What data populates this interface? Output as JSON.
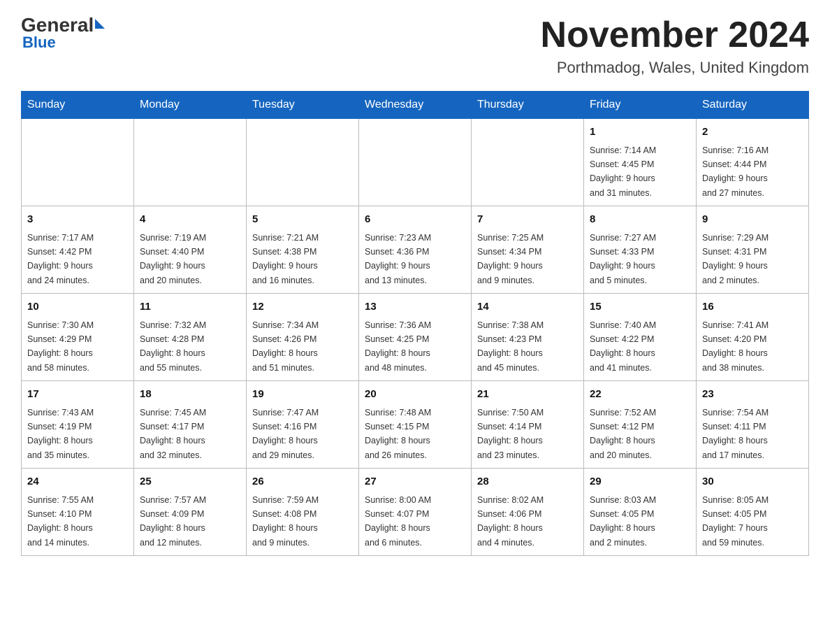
{
  "header": {
    "logo_general": "General",
    "logo_blue": "Blue",
    "title": "November 2024",
    "subtitle": "Porthmadog, Wales, United Kingdom"
  },
  "weekdays": [
    "Sunday",
    "Monday",
    "Tuesday",
    "Wednesday",
    "Thursday",
    "Friday",
    "Saturday"
  ],
  "rows": [
    {
      "cells": [
        {
          "day": "",
          "info": ""
        },
        {
          "day": "",
          "info": ""
        },
        {
          "day": "",
          "info": ""
        },
        {
          "day": "",
          "info": ""
        },
        {
          "day": "",
          "info": ""
        },
        {
          "day": "1",
          "info": "Sunrise: 7:14 AM\nSunset: 4:45 PM\nDaylight: 9 hours\nand 31 minutes."
        },
        {
          "day": "2",
          "info": "Sunrise: 7:16 AM\nSunset: 4:44 PM\nDaylight: 9 hours\nand 27 minutes."
        }
      ]
    },
    {
      "cells": [
        {
          "day": "3",
          "info": "Sunrise: 7:17 AM\nSunset: 4:42 PM\nDaylight: 9 hours\nand 24 minutes."
        },
        {
          "day": "4",
          "info": "Sunrise: 7:19 AM\nSunset: 4:40 PM\nDaylight: 9 hours\nand 20 minutes."
        },
        {
          "day": "5",
          "info": "Sunrise: 7:21 AM\nSunset: 4:38 PM\nDaylight: 9 hours\nand 16 minutes."
        },
        {
          "day": "6",
          "info": "Sunrise: 7:23 AM\nSunset: 4:36 PM\nDaylight: 9 hours\nand 13 minutes."
        },
        {
          "day": "7",
          "info": "Sunrise: 7:25 AM\nSunset: 4:34 PM\nDaylight: 9 hours\nand 9 minutes."
        },
        {
          "day": "8",
          "info": "Sunrise: 7:27 AM\nSunset: 4:33 PM\nDaylight: 9 hours\nand 5 minutes."
        },
        {
          "day": "9",
          "info": "Sunrise: 7:29 AM\nSunset: 4:31 PM\nDaylight: 9 hours\nand 2 minutes."
        }
      ]
    },
    {
      "cells": [
        {
          "day": "10",
          "info": "Sunrise: 7:30 AM\nSunset: 4:29 PM\nDaylight: 8 hours\nand 58 minutes."
        },
        {
          "day": "11",
          "info": "Sunrise: 7:32 AM\nSunset: 4:28 PM\nDaylight: 8 hours\nand 55 minutes."
        },
        {
          "day": "12",
          "info": "Sunrise: 7:34 AM\nSunset: 4:26 PM\nDaylight: 8 hours\nand 51 minutes."
        },
        {
          "day": "13",
          "info": "Sunrise: 7:36 AM\nSunset: 4:25 PM\nDaylight: 8 hours\nand 48 minutes."
        },
        {
          "day": "14",
          "info": "Sunrise: 7:38 AM\nSunset: 4:23 PM\nDaylight: 8 hours\nand 45 minutes."
        },
        {
          "day": "15",
          "info": "Sunrise: 7:40 AM\nSunset: 4:22 PM\nDaylight: 8 hours\nand 41 minutes."
        },
        {
          "day": "16",
          "info": "Sunrise: 7:41 AM\nSunset: 4:20 PM\nDaylight: 8 hours\nand 38 minutes."
        }
      ]
    },
    {
      "cells": [
        {
          "day": "17",
          "info": "Sunrise: 7:43 AM\nSunset: 4:19 PM\nDaylight: 8 hours\nand 35 minutes."
        },
        {
          "day": "18",
          "info": "Sunrise: 7:45 AM\nSunset: 4:17 PM\nDaylight: 8 hours\nand 32 minutes."
        },
        {
          "day": "19",
          "info": "Sunrise: 7:47 AM\nSunset: 4:16 PM\nDaylight: 8 hours\nand 29 minutes."
        },
        {
          "day": "20",
          "info": "Sunrise: 7:48 AM\nSunset: 4:15 PM\nDaylight: 8 hours\nand 26 minutes."
        },
        {
          "day": "21",
          "info": "Sunrise: 7:50 AM\nSunset: 4:14 PM\nDaylight: 8 hours\nand 23 minutes."
        },
        {
          "day": "22",
          "info": "Sunrise: 7:52 AM\nSunset: 4:12 PM\nDaylight: 8 hours\nand 20 minutes."
        },
        {
          "day": "23",
          "info": "Sunrise: 7:54 AM\nSunset: 4:11 PM\nDaylight: 8 hours\nand 17 minutes."
        }
      ]
    },
    {
      "cells": [
        {
          "day": "24",
          "info": "Sunrise: 7:55 AM\nSunset: 4:10 PM\nDaylight: 8 hours\nand 14 minutes."
        },
        {
          "day": "25",
          "info": "Sunrise: 7:57 AM\nSunset: 4:09 PM\nDaylight: 8 hours\nand 12 minutes."
        },
        {
          "day": "26",
          "info": "Sunrise: 7:59 AM\nSunset: 4:08 PM\nDaylight: 8 hours\nand 9 minutes."
        },
        {
          "day": "27",
          "info": "Sunrise: 8:00 AM\nSunset: 4:07 PM\nDaylight: 8 hours\nand 6 minutes."
        },
        {
          "day": "28",
          "info": "Sunrise: 8:02 AM\nSunset: 4:06 PM\nDaylight: 8 hours\nand 4 minutes."
        },
        {
          "day": "29",
          "info": "Sunrise: 8:03 AM\nSunset: 4:05 PM\nDaylight: 8 hours\nand 2 minutes."
        },
        {
          "day": "30",
          "info": "Sunrise: 8:05 AM\nSunset: 4:05 PM\nDaylight: 7 hours\nand 59 minutes."
        }
      ]
    }
  ],
  "colors": {
    "header_bg": "#1565c0",
    "header_text": "#ffffff",
    "border": "#9baec8",
    "row_alt": "#f5f5f5"
  }
}
